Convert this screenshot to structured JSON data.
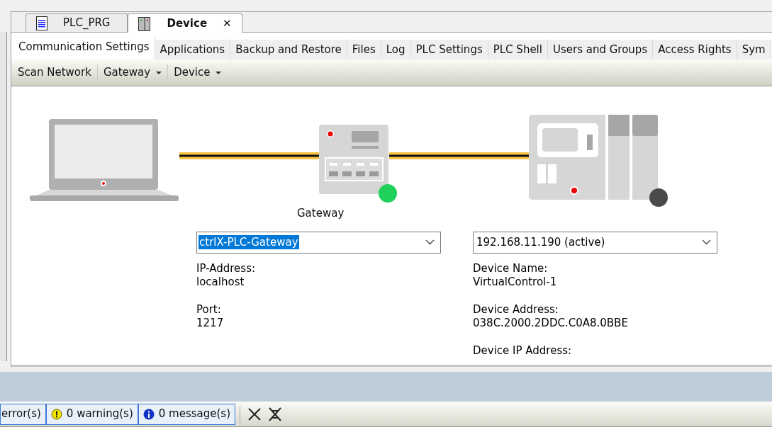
{
  "editor_tabs": [
    {
      "label": "PLC_PRG",
      "kind": "program",
      "selected": false
    },
    {
      "label": "Device",
      "kind": "device",
      "selected": true,
      "close": "✕"
    }
  ],
  "sub_tabs": [
    {
      "label": "Communication Settings",
      "selected": true
    },
    {
      "label": "Applications",
      "selected": false
    },
    {
      "label": "Backup and Restore",
      "selected": false
    },
    {
      "label": "Files",
      "selected": false
    },
    {
      "label": "Log",
      "selected": false
    },
    {
      "label": "PLC Settings",
      "selected": false
    },
    {
      "label": "PLC Shell",
      "selected": false
    },
    {
      "label": "Users and Groups",
      "selected": false
    },
    {
      "label": "Access Rights",
      "selected": false
    },
    {
      "label": "Sym",
      "selected": false
    }
  ],
  "toolbar": [
    {
      "label": "Scan Network",
      "dropdown": false
    },
    {
      "label": "Gateway",
      "dropdown": true
    },
    {
      "label": "Device",
      "dropdown": true
    }
  ],
  "nodes": [
    {
      "kind": "gateway",
      "caption": "Gateway",
      "color": "#1fd15a"
    },
    {
      "kind": "device",
      "color": "#4a4a4a"
    }
  ],
  "gateway_panel": {
    "select": {
      "value": "ctrlX-PLC-Gateway",
      "highlighted": true
    },
    "info": [
      {
        "label": "IP-Address:",
        "value": "localhost"
      },
      {
        "label": "Port:",
        "value": "1217"
      }
    ]
  },
  "device_panel": {
    "select": {
      "value": "192.168.11.190 (active)",
      "highlighted": false
    },
    "info": [
      {
        "label": "Device Name:",
        "value": "VirtualControl-1"
      },
      {
        "label": "Device Address:",
        "value": "038C.2000.2DDC.C0A8.0BBE"
      },
      {
        "label": "Device IP Address:"
      }
    ]
  },
  "messages": [
    {
      "kind": "error",
      "label": "error(s)"
    },
    {
      "kind": "warning",
      "label": "0 warning(s)"
    },
    {
      "kind": "info",
      "label": "0 message(s)"
    }
  ]
}
